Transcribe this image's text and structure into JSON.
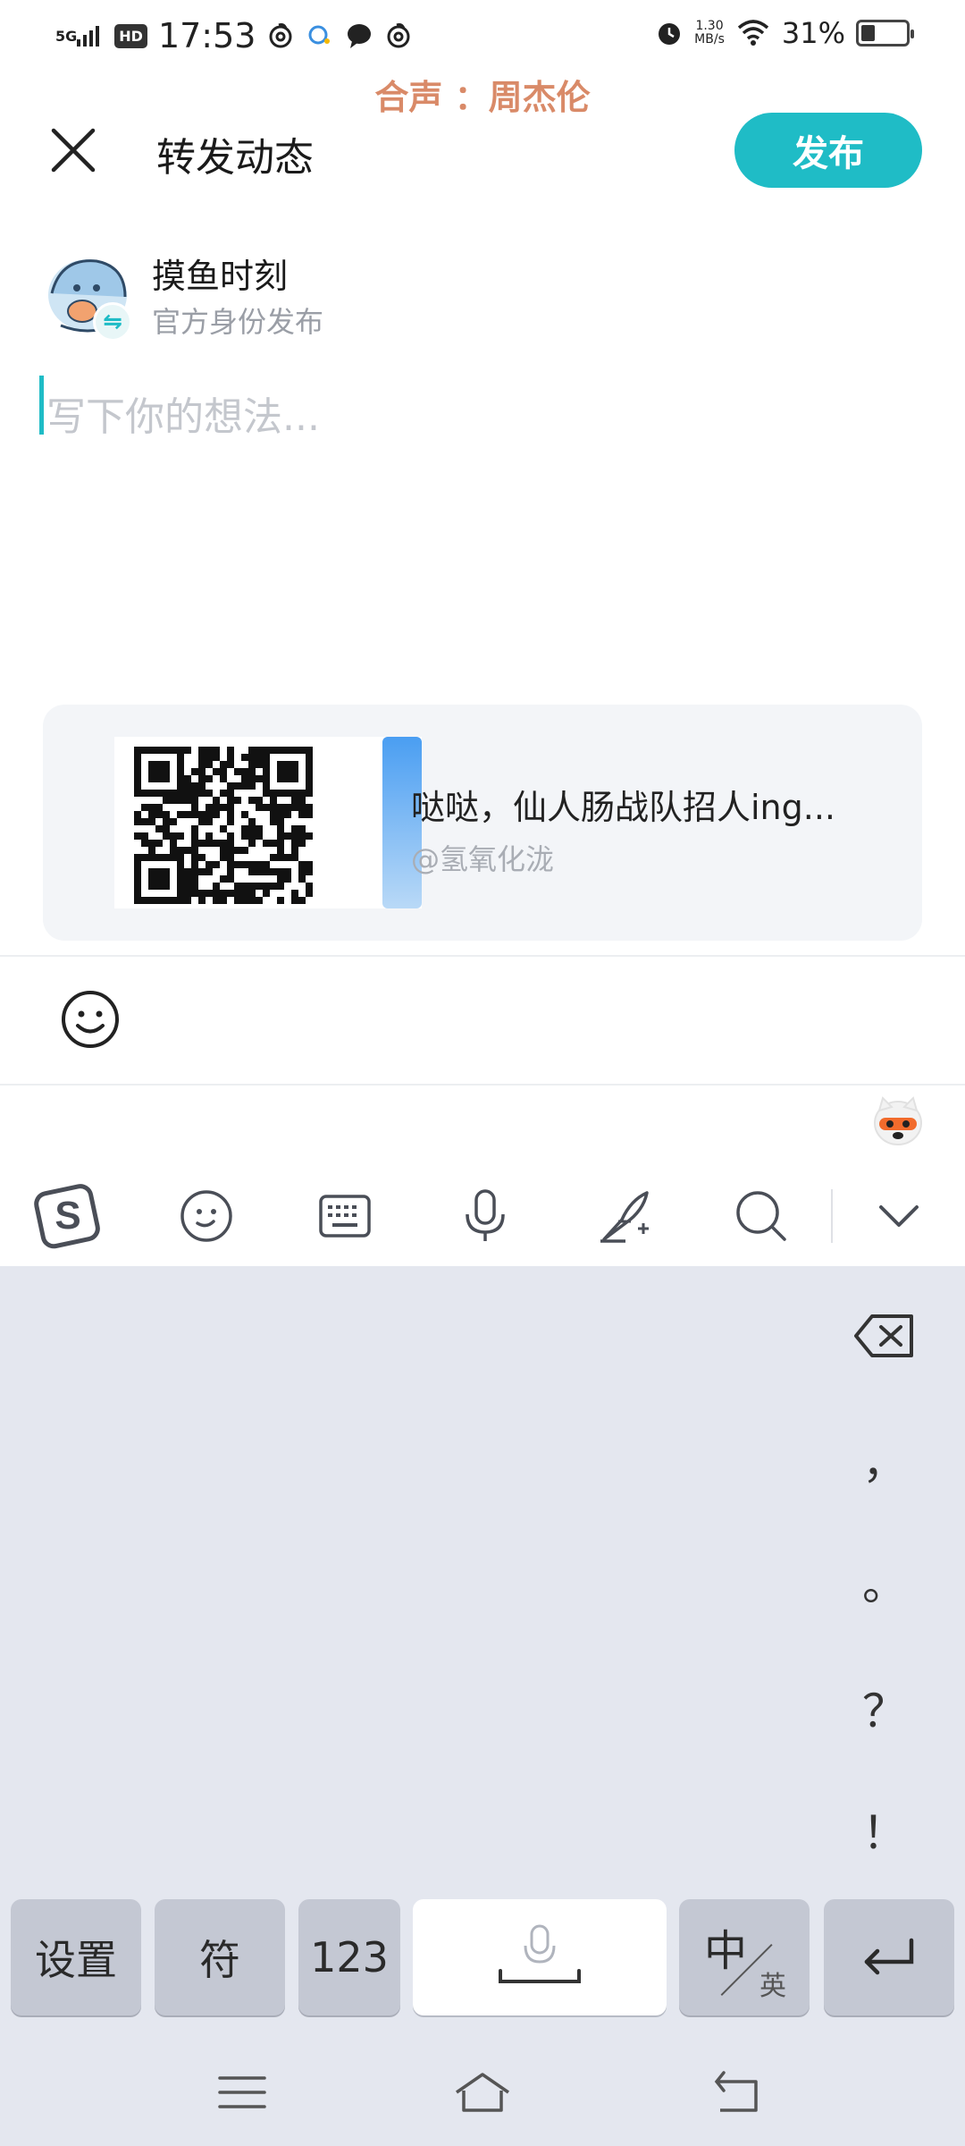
{
  "status_bar": {
    "network": "5G",
    "hd": "HD",
    "time": "17:53",
    "speed_value": "1.30",
    "speed_unit": "MB/s",
    "battery": "31%",
    "battery_level": 0.31
  },
  "lyric": "合声 ：周杰伦",
  "header": {
    "title": "转发动态",
    "publish_label": "发布"
  },
  "identity": {
    "name": "摸鱼时刻",
    "sub": "官方身份发布",
    "badge": "⇋"
  },
  "compose": {
    "placeholder": "写下你的想法..."
  },
  "shared_card": {
    "title": "哒哒，仙人肠战队招人ing...",
    "author": "@氢氧化泷"
  },
  "ime": {
    "punctuation": [
      "，",
      "。",
      "？",
      "！"
    ],
    "keys": {
      "settings": "设置",
      "symbols": "符",
      "numbers": "123",
      "lang_main": "中",
      "lang_sub": "英"
    }
  },
  "colors": {
    "accent": "#1fbcc6",
    "lyric": "#d98a68",
    "keyboard_bg": "#e4e7ef"
  }
}
